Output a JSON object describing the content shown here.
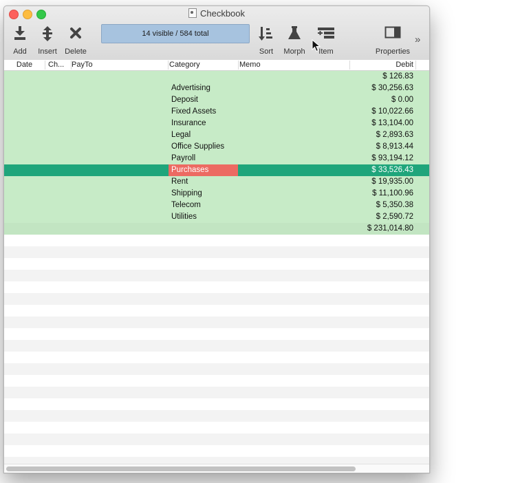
{
  "window": {
    "title": "Checkbook"
  },
  "toolbar": {
    "add": "Add",
    "insert": "Insert",
    "delete": "Delete",
    "status": "14 visible / 584 total",
    "sort": "Sort",
    "morph": "Morph",
    "item": "Item",
    "properties": "Properties",
    "more": "»",
    "icons": {
      "add": "add-arrow-down-icon",
      "insert": "insert-arrows-icon",
      "delete": "delete-x-icon",
      "sort": "sort-icon",
      "morph": "flask-icon",
      "item": "item-list-icon",
      "properties": "sidebar-panel-icon"
    }
  },
  "columns": [
    "Date",
    "Ch...",
    "PayTo",
    "Category",
    "Memo",
    "Debit"
  ],
  "rows": [
    {
      "category": "",
      "debit": "$ 126.83"
    },
    {
      "category": "Advertising",
      "debit": "$ 30,256.63"
    },
    {
      "category": "Deposit",
      "debit": "$ 0.00"
    },
    {
      "category": "Fixed Assets",
      "debit": "$ 10,022.66"
    },
    {
      "category": "Insurance",
      "debit": "$ 13,104.00"
    },
    {
      "category": "Legal",
      "debit": "$ 2,893.63"
    },
    {
      "category": "Office Supplies",
      "debit": "$ 8,913.44"
    },
    {
      "category": "Payroll",
      "debit": "$ 93,194.12"
    },
    {
      "category": "Purchases",
      "debit": "$ 33,526.43"
    },
    {
      "category": "Rent",
      "debit": "$ 19,935.00"
    },
    {
      "category": "Shipping",
      "debit": "$ 11,100.96"
    },
    {
      "category": "Telecom",
      "debit": "$ 5,350.38"
    },
    {
      "category": "Utilities",
      "debit": "$ 2,590.72"
    },
    {
      "category": "",
      "debit": "$ 231,014.80"
    }
  ],
  "selected_row": "Purchases",
  "colors": {
    "row_green": "#c7ebc7",
    "selected": "#1fa57b",
    "selected_category": "#ec6a62",
    "status_box": "#a7c3df"
  }
}
